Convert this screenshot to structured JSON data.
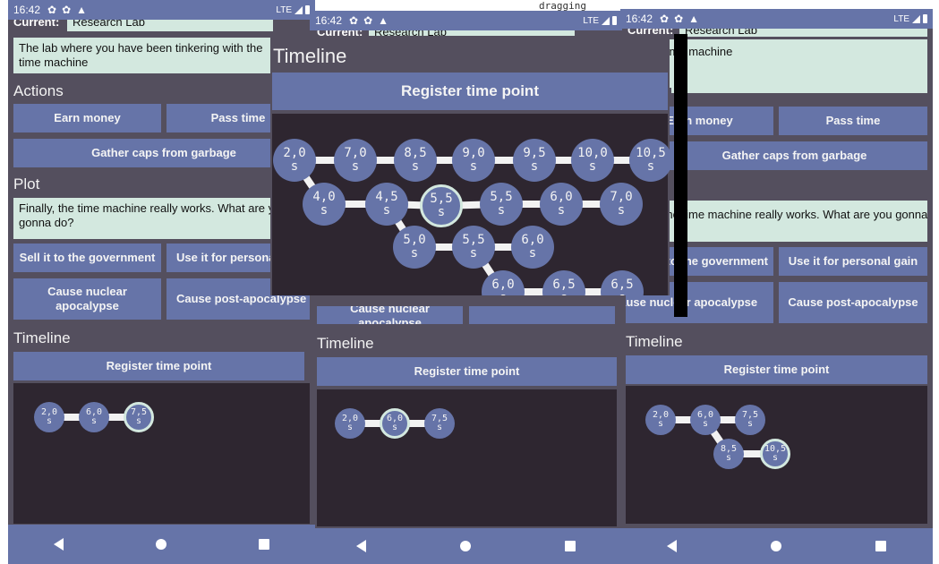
{
  "drag_indicator": "dragging",
  "status": {
    "time": "16:42",
    "network": "LTE"
  },
  "screen_common": {
    "current_label": "Current:",
    "current_value": "Research Lab",
    "location_text": "The lab where you have been tinkering with the time machine",
    "actions_title": "Actions",
    "earn_money": "Earn money",
    "pass_time": "Pass time",
    "gather_caps": "Gather caps from garbage",
    "plot_title": "Plot",
    "plot_text": "Finally, the time machine really works. What are you gonna do?",
    "sell_gov": "Sell it to the government",
    "personal_gain": "Use it for personal gain",
    "nuclear": "Cause nuclear apocalypse",
    "post_apoc": "Cause post-apocalypse",
    "timeline_title": "Timeline",
    "register": "Register time point",
    "unit": "s"
  },
  "phone1_timeline": [
    {
      "label": "2,0"
    },
    {
      "label": "6,0"
    },
    {
      "label": "7,5",
      "selected": true
    }
  ],
  "phone2_timeline": [
    {
      "label": "2,0"
    },
    {
      "label": "6,0",
      "selected": true
    },
    {
      "label": "7,5"
    }
  ],
  "phone3_timeline": [
    {
      "label": "2,0"
    },
    {
      "label": "6,0"
    },
    {
      "label": "7,5"
    },
    {
      "label": "8,5"
    },
    {
      "label": "10,5",
      "selected": true
    }
  ],
  "zoom_timeline": [
    {
      "label": "2,0"
    },
    {
      "label": "7,0"
    },
    {
      "label": "8,5"
    },
    {
      "label": "9,0"
    },
    {
      "label": "9,5"
    },
    {
      "label": "10,0"
    },
    {
      "label": "10,5"
    },
    {
      "label": "4,0"
    },
    {
      "label": "4,5"
    },
    {
      "label": "5,5",
      "selected": true
    },
    {
      "label": "5,5"
    },
    {
      "label": "6,0"
    },
    {
      "label": "7,0"
    },
    {
      "label": "5,0"
    },
    {
      "label": "5,5"
    },
    {
      "label": "6,0"
    },
    {
      "label": "6,0"
    },
    {
      "label": "6,5"
    },
    {
      "label": "6,5"
    }
  ]
}
